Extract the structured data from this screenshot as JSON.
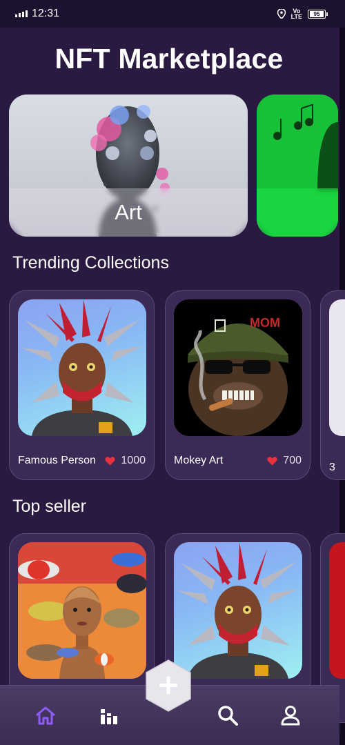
{
  "status": {
    "time": "12:31",
    "network": "Vo)) LTE",
    "battery": "95"
  },
  "header": {
    "title": "NFT Marketplace"
  },
  "categories": [
    {
      "label": "Art"
    },
    {
      "label": "Music"
    }
  ],
  "trending": {
    "title": "Trending Collections",
    "items": [
      {
        "name": "Famous Person",
        "likes": "1000"
      },
      {
        "name": "Mokey Art",
        "likes": "700"
      },
      {
        "name": "3",
        "likes": ""
      }
    ]
  },
  "top_seller": {
    "title": "Top seller"
  },
  "nav": {
    "items": [
      "home-icon",
      "ranking-icon",
      "search-icon",
      "profile-icon"
    ],
    "fab": "plus-icon",
    "active_color": "#8f5cf5"
  },
  "colors": {
    "background": "#2a1a42",
    "card": "#3a2a55",
    "heart": "#e8323f"
  }
}
